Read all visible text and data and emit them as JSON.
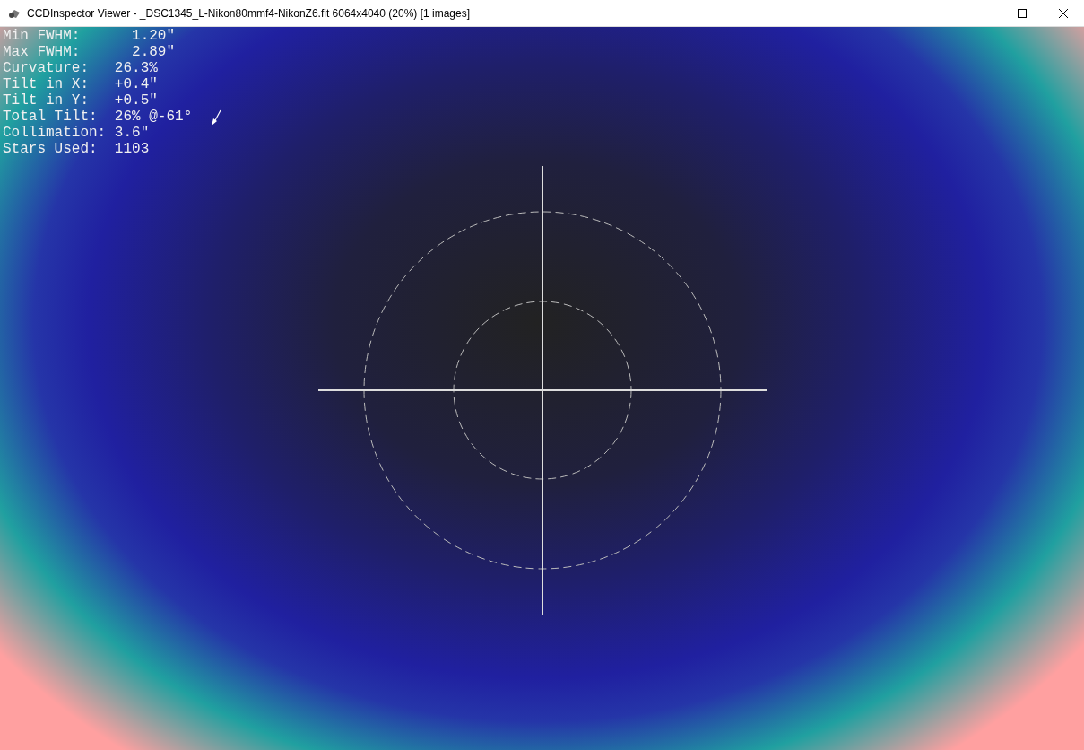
{
  "window": {
    "title": "CCDInspector Viewer - _DSC1345_L-Nikon80mmf4-NikonZ6.fit 6064x4040 (20%)  [1 images]"
  },
  "stats": [
    "Min FWHM:      1.20\"",
    "Max FWHM:      2.89\"",
    "Curvature:   26.3%",
    "Tilt in X:   +0.4\"",
    "Tilt in Y:   +0.5\"",
    "Total Tilt:  26% @-61°",
    "Collimation: 3.6\"",
    "Stars Used:  1103"
  ]
}
